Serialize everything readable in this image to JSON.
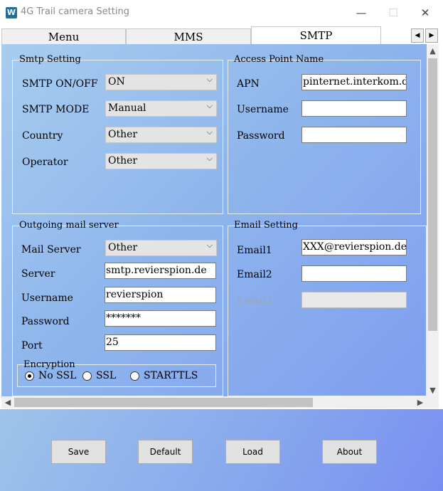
{
  "window": {
    "title": "4G Trail camera Setting",
    "app_icon": "W",
    "minimize": "—",
    "maximize": "☐",
    "close": "✕"
  },
  "tabs": [
    {
      "label": "Menu"
    },
    {
      "label": "MMS"
    },
    {
      "label": "SMTP"
    }
  ],
  "active_tab": "SMTP",
  "tab_scroll": {
    "left": "◀",
    "right": "▶"
  },
  "smtp_setting": {
    "legend": "Smtp Setting",
    "rows": [
      {
        "label": "SMTP ON/OFF",
        "value": "ON"
      },
      {
        "label": "SMTP MODE",
        "value": "Manual"
      },
      {
        "label": "Country",
        "value": "Other"
      },
      {
        "label": "Operator",
        "value": "Other"
      }
    ]
  },
  "apn": {
    "legend": "Access Point Name",
    "rows": [
      {
        "label": "APN",
        "value": "pinternet.interkom.de"
      },
      {
        "label": "Username",
        "value": ""
      },
      {
        "label": "Password",
        "value": ""
      }
    ]
  },
  "outgoing": {
    "legend": "Outgoing mail server",
    "mail_server_label": "Mail Server",
    "mail_server_value": "Other",
    "server_label": "Server",
    "server_value": "smtp.revierspion.de",
    "username_label": "Username",
    "username_value": "revierspion",
    "password_label": "Password",
    "password_value": "*******",
    "port_label": "Port",
    "port_value": "25"
  },
  "encryption": {
    "legend": "Encryption",
    "options": [
      "No SSL",
      "SSL",
      "STARTTLS"
    ],
    "selected": "No SSL"
  },
  "email_setting": {
    "legend": "Email Setting",
    "rows": [
      {
        "label": "Email1",
        "value": "XXX@revierspion.de"
      },
      {
        "label": "Email2",
        "value": ""
      },
      {
        "label": "Email3",
        "value": ""
      }
    ]
  },
  "buttons": {
    "save": "Save",
    "default": "Default",
    "load": "Load",
    "about": "About"
  },
  "scroll_glyphs": {
    "up": "▲",
    "down": "▼",
    "left": "◀",
    "right": "▶"
  },
  "dropdown_glyph": "⌵"
}
